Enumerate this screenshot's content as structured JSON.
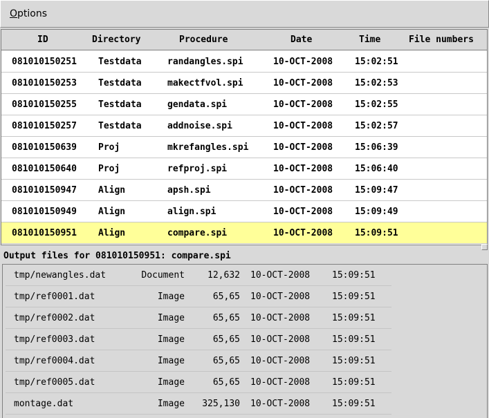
{
  "menu": {
    "options_mnemonic": "O",
    "options_rest": "ptions"
  },
  "jobs": {
    "columns": [
      "ID",
      "Directory",
      "Procedure",
      "Date",
      "Time",
      "File numbers"
    ],
    "rows": [
      {
        "id": "081010150251",
        "dir": "Testdata",
        "proc": "randangles.spi",
        "date": "10-OCT-2008",
        "time": "15:02:51",
        "files": ""
      },
      {
        "id": "081010150253",
        "dir": "Testdata",
        "proc": "makectfvol.spi",
        "date": "10-OCT-2008",
        "time": "15:02:53",
        "files": ""
      },
      {
        "id": "081010150255",
        "dir": "Testdata",
        "proc": "gendata.spi",
        "date": "10-OCT-2008",
        "time": "15:02:55",
        "files": ""
      },
      {
        "id": "081010150257",
        "dir": "Testdata",
        "proc": "addnoise.spi",
        "date": "10-OCT-2008",
        "time": "15:02:57",
        "files": ""
      },
      {
        "id": "081010150639",
        "dir": "Proj",
        "proc": "mkrefangles.spi",
        "date": "10-OCT-2008",
        "time": "15:06:39",
        "files": ""
      },
      {
        "id": "081010150640",
        "dir": "Proj",
        "proc": "refproj.spi",
        "date": "10-OCT-2008",
        "time": "15:06:40",
        "files": ""
      },
      {
        "id": "081010150947",
        "dir": "Align",
        "proc": "apsh.spi",
        "date": "10-OCT-2008",
        "time": "15:09:47",
        "files": ""
      },
      {
        "id": "081010150949",
        "dir": "Align",
        "proc": "align.spi",
        "date": "10-OCT-2008",
        "time": "15:09:49",
        "files": ""
      },
      {
        "id": "081010150951",
        "dir": "Align",
        "proc": "compare.spi",
        "date": "10-OCT-2008",
        "time": "15:09:51",
        "files": ""
      }
    ],
    "selected_index": 8,
    "selected_color": "#ffff99"
  },
  "outputs": {
    "title": "Output files for 081010150951: compare.spi",
    "rows": [
      {
        "file": "tmp/newangles.dat",
        "type": "Document",
        "size": "12,632",
        "date": "10-OCT-2008",
        "time": "15:09:51"
      },
      {
        "file": "tmp/ref0001.dat",
        "type": "Image",
        "size": "65,65",
        "date": "10-OCT-2008",
        "time": "15:09:51"
      },
      {
        "file": "tmp/ref0002.dat",
        "type": "Image",
        "size": "65,65",
        "date": "10-OCT-2008",
        "time": "15:09:51"
      },
      {
        "file": "tmp/ref0003.dat",
        "type": "Image",
        "size": "65,65",
        "date": "10-OCT-2008",
        "time": "15:09:51"
      },
      {
        "file": "tmp/ref0004.dat",
        "type": "Image",
        "size": "65,65",
        "date": "10-OCT-2008",
        "time": "15:09:51"
      },
      {
        "file": "tmp/ref0005.dat",
        "type": "Image",
        "size": "65,65",
        "date": "10-OCT-2008",
        "time": "15:09:51"
      },
      {
        "file": "montage.dat",
        "type": "Image",
        "size": "325,130",
        "date": "10-OCT-2008",
        "time": "15:09:51"
      }
    ]
  }
}
